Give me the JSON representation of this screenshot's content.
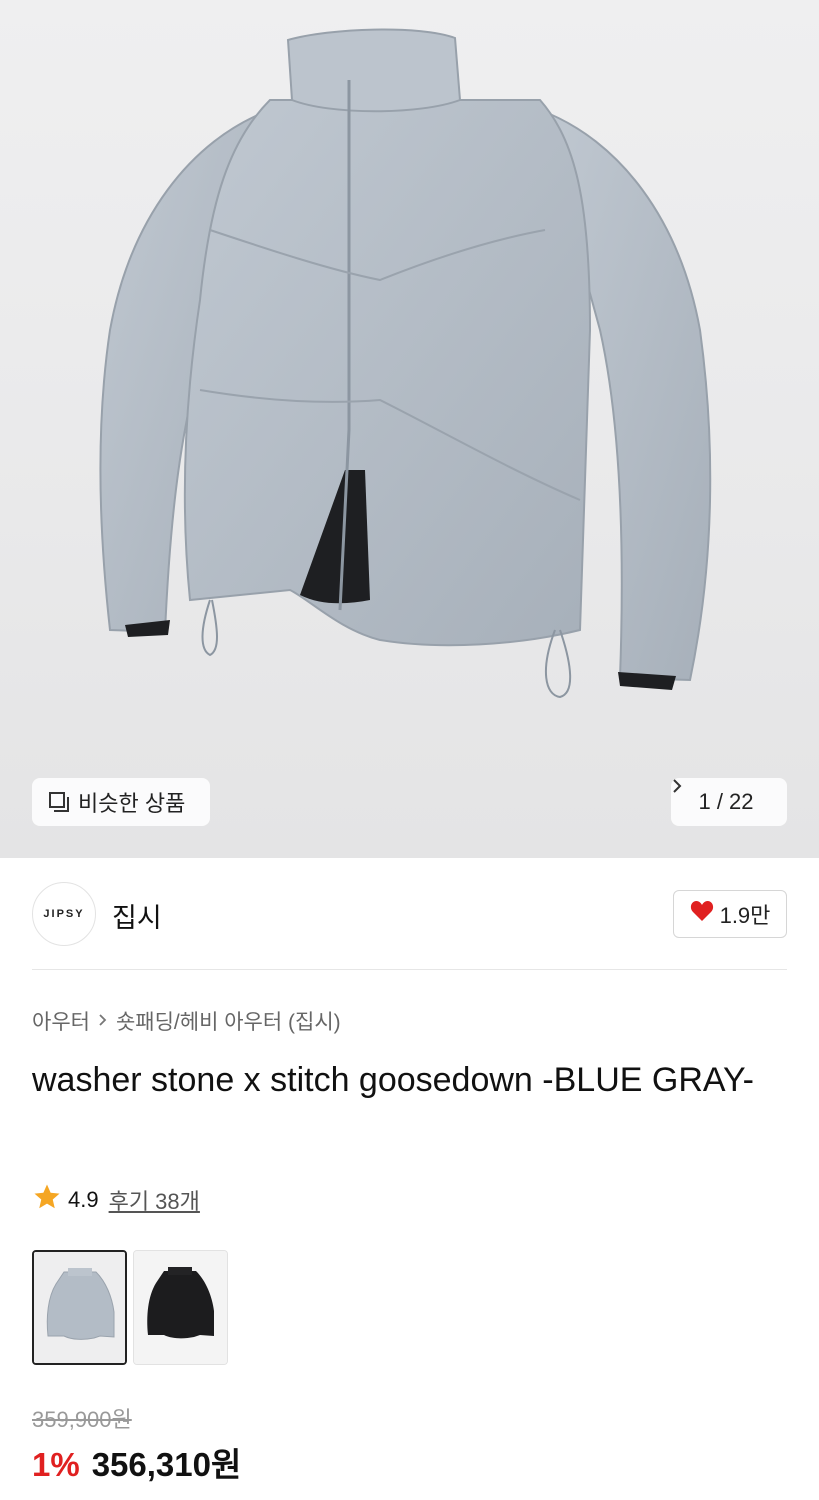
{
  "hero": {
    "similar_button_label": "비슷한 상품",
    "image_counter": "1 / 22"
  },
  "brand": {
    "logo_text": "JIPSY",
    "name": "집시",
    "like_count": "1.9만"
  },
  "breadcrumb": {
    "items": [
      "아우터",
      "숏패딩/헤비 아우터 (집시)"
    ]
  },
  "product": {
    "title": "washer stone x stitch goosedown -BLUE GRAY-",
    "rating": "4.9",
    "reviews": "후기 38개",
    "original_price": "359,900원",
    "discount": "1%",
    "final_price": "356,310원",
    "colors": [
      "BLUE GRAY",
      "BLACK"
    ]
  },
  "colors": {
    "accent_red": "#e02020",
    "star": "#f5a623",
    "jacket": "#b3bcc6"
  }
}
